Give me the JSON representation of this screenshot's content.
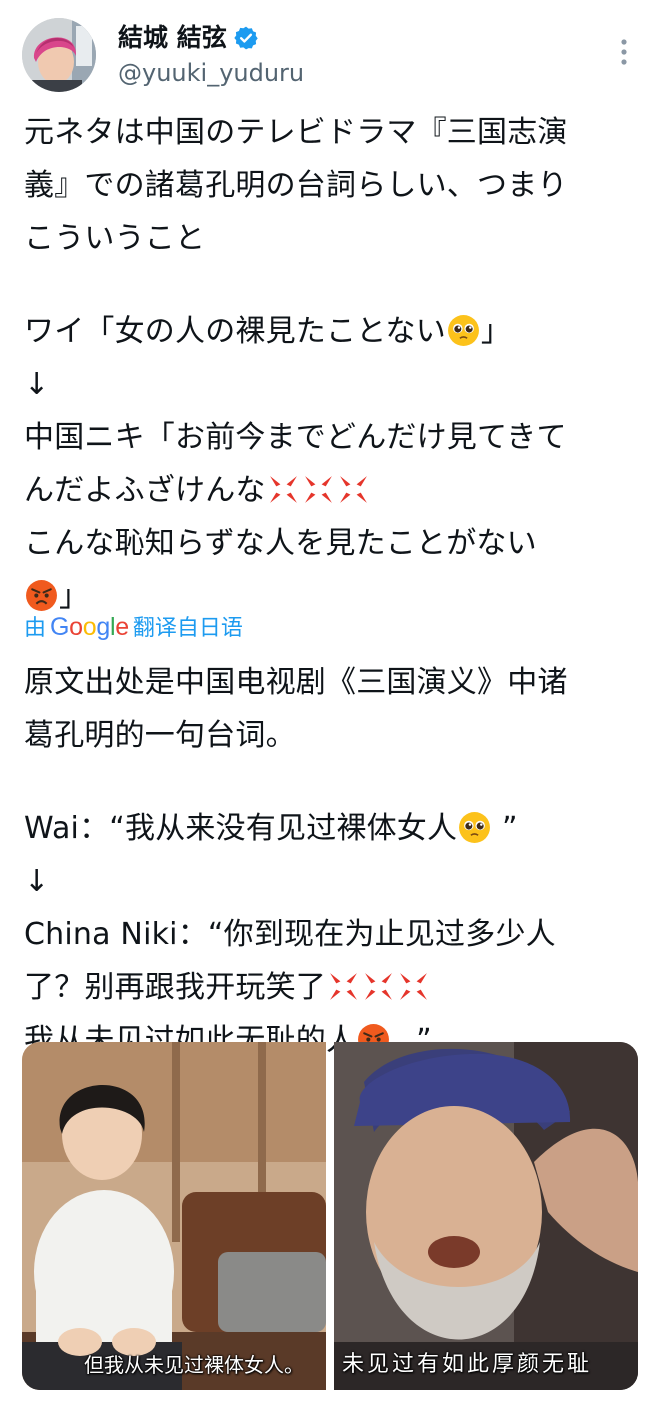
{
  "author": {
    "display_name": "結城 結弦",
    "handle": "@yuuki_yuduru",
    "verified_icon": "verified-badge-icon",
    "accent": "#1d9bf0"
  },
  "tweet": {
    "lines_before_gap": [
      "元ネタは中国のテレビドラマ『三国志演",
      "義』での諸葛孔明の台詞らしい、つまり",
      "こういうこと"
    ],
    "ワイ_line_a": "ワイ「女の人の裸見たことない",
    "ワイ_line_b": "」",
    "arrow": "↓",
    "china_line_1": "中国ニキ「お前今までどんだけ見てきて",
    "china_line_2": "んだよふざけんな",
    "china_line_3": "こんな恥知らずな人を見たことがない",
    "china_line_4": "」"
  },
  "translation_bar": {
    "prefix": "由",
    "google": "Google",
    "suffix": "翻译自日语"
  },
  "translated": {
    "line_1": "原文出处是中国电视剧《三国演义》中诸",
    "line_2": "葛孔明的一句台词。",
    "wai_a": "Wai：“我从来没有见过裸体女人",
    "wai_b": " ”",
    "arrow": "↓",
    "china_1": "China Niki：“你到现在为止见过多少人",
    "china_2": "了？别再跟我开玩笑了",
    "china_3a": "我从未见过如此无耻的人",
    "china_3b": " 。”"
  },
  "media": {
    "left_caption": "但我从未见过裸体女人。",
    "right_caption": "未见过有如此厚颜无耻"
  },
  "icons": {
    "pleading_face": "pleading-face-emoji",
    "anger_symbol": "anger-symbol-emoji",
    "angry_face": "angry-face-emoji",
    "more": "more-vertical-icon"
  }
}
